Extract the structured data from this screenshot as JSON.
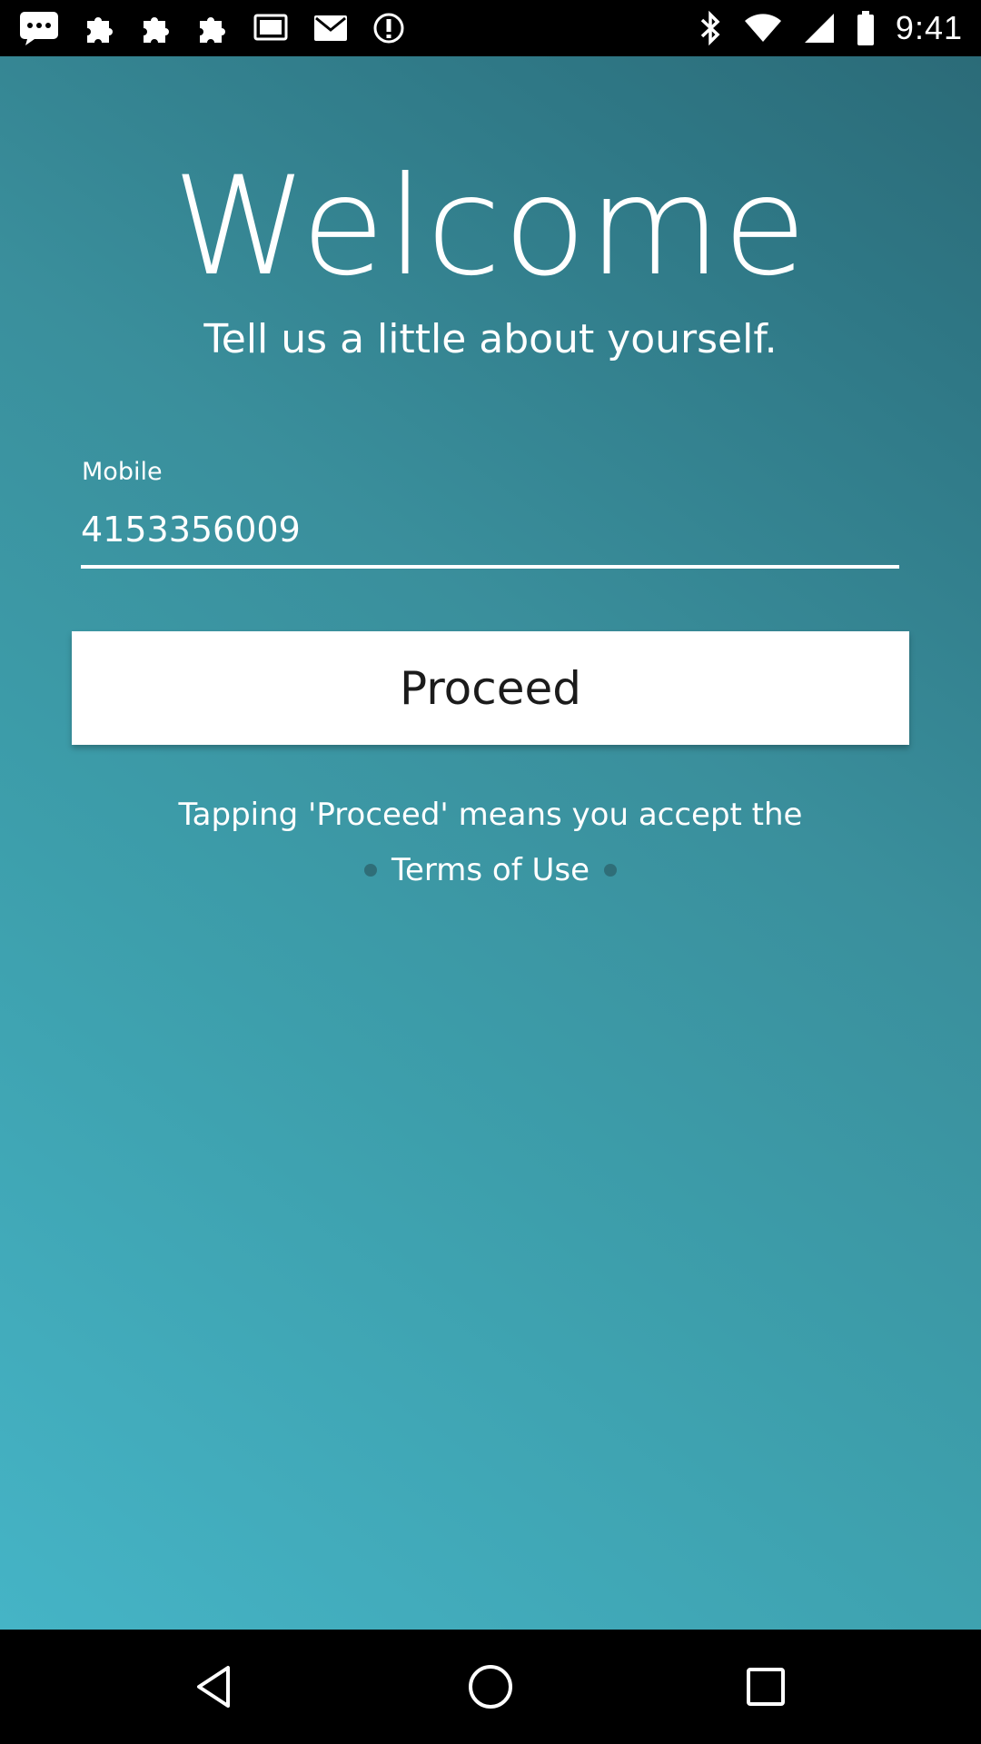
{
  "status_bar": {
    "time": "9:41",
    "left_icons": [
      "messages-icon",
      "puzzle-icon",
      "puzzle-icon",
      "puzzle-icon",
      "cast-icon",
      "mail-icon",
      "do-not-disturb-icon"
    ],
    "right_icons": [
      "bluetooth-icon",
      "wifi-icon",
      "signal-icon",
      "battery-icon"
    ]
  },
  "welcome": {
    "title": "Welcome",
    "subtitle": "Tell us a little about yourself."
  },
  "form": {
    "mobile_label": "Mobile",
    "mobile_value": "4153356009",
    "proceed_label": "Proceed"
  },
  "footer": {
    "disclaimer": "Tapping 'Proceed' means you accept the",
    "terms_link": "Terms of Use"
  },
  "colors": {
    "gradient_light": "#45b4c6",
    "gradient_dark": "#2b6b78",
    "button_bg": "#ffffff",
    "text": "#ffffff"
  },
  "nav_bar": {
    "buttons": [
      "back-icon",
      "home-icon",
      "recent-apps-icon"
    ]
  }
}
